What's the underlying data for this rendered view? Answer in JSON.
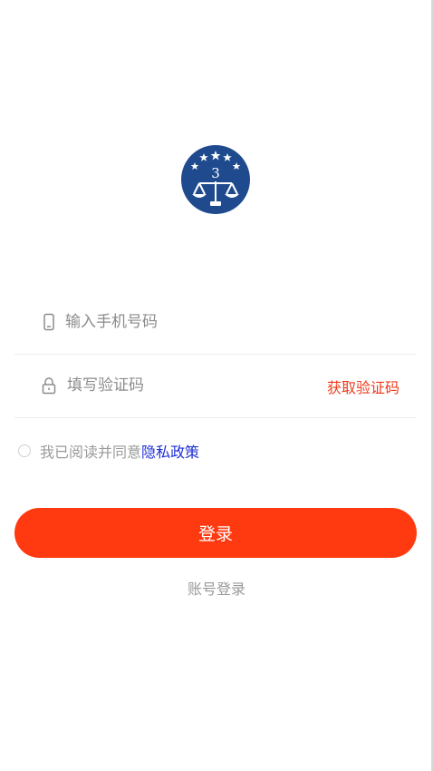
{
  "logo": {
    "icon": "scales-of-justice-emblem-icon",
    "colors": {
      "background": "#1f4b8e",
      "symbol": "#ffffff"
    }
  },
  "phone_field": {
    "icon": "phone-icon",
    "placeholder": "输入手机号码",
    "value": ""
  },
  "code_field": {
    "icon": "lock-icon",
    "placeholder": "填写验证码",
    "value": "",
    "get_code_label": "获取验证码"
  },
  "agreement": {
    "checked": false,
    "text": "我已阅读并同意",
    "policy_link": "隐私政策"
  },
  "login_button": {
    "label": "登录"
  },
  "account_login": {
    "label": "账号登录"
  },
  "colors": {
    "accent": "#ff3a10",
    "link": "#1f2fd6",
    "muted_text": "#9a9a9a"
  }
}
